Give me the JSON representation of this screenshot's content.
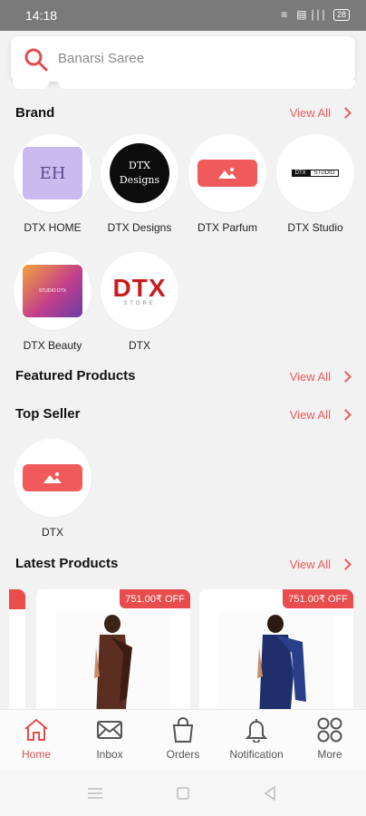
{
  "status_bar": {
    "time": "14:18",
    "indicators": "≡   ▤ ∣∣∣",
    "battery": "28"
  },
  "search": {
    "placeholder": "Banarsi Saree"
  },
  "sections": {
    "brand": {
      "title": "Brand",
      "view_all": "View All"
    },
    "featured": {
      "title": "Featured Products",
      "view_all": "View All"
    },
    "top_seller": {
      "title": "Top Seller",
      "view_all": "View All"
    },
    "latest": {
      "title": "Latest Products",
      "view_all": "View All"
    }
  },
  "brands": [
    {
      "name": "DTX HOME",
      "logo_text": "EH"
    },
    {
      "name": "DTX Designs",
      "logo_line1": "DTX",
      "logo_line2": "Designs"
    },
    {
      "name": "DTX Parfum"
    },
    {
      "name": "DTX Studio",
      "logo_text_a": "DTX",
      "logo_text_b": "STUDIO"
    },
    {
      "name": "DTX Beauty",
      "logo_text": "STUDIO DTX"
    },
    {
      "name": "DTX",
      "logo_big": "DTX",
      "logo_small": "STORE"
    }
  ],
  "top_sellers": [
    {
      "name": "DTX"
    }
  ],
  "products": [
    {
      "badge": "751.00₹ OFF"
    },
    {
      "badge": "751.00₹ OFF"
    }
  ],
  "bottom_nav": [
    {
      "label": "Home",
      "icon": "home-icon",
      "active": true
    },
    {
      "label": "Inbox",
      "icon": "inbox-icon"
    },
    {
      "label": "Orders",
      "icon": "bag-icon"
    },
    {
      "label": "Notification",
      "icon": "bell-icon"
    },
    {
      "label": "More",
      "icon": "grid-icon"
    }
  ],
  "colors": {
    "accent": "#ef5b5b",
    "badge": "#e84c4c",
    "placeholder_red": "#f15a5a"
  }
}
